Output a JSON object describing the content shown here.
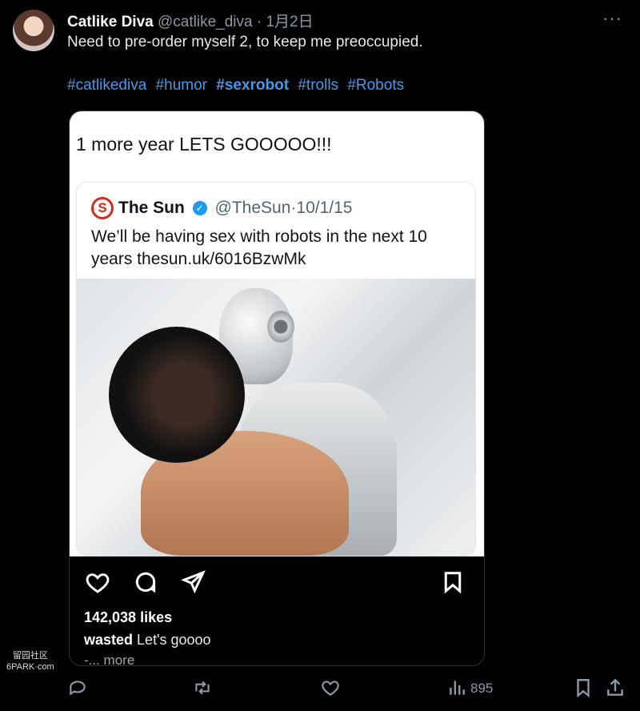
{
  "author": {
    "display_name": "Catlike Diva",
    "handle": "@catlike_diva",
    "date": "1月2日"
  },
  "post": {
    "text": "Need to pre-order myself 2, to keep me preoccupied.",
    "hashtags": [
      "#catlikediva",
      "#humor",
      "#sexrobot",
      "#trolls",
      "#Robots"
    ]
  },
  "card": {
    "caption": "1 more year LETS GOOOOO!!!",
    "quote": {
      "logo_letter": "S",
      "name": "The Sun",
      "handle": "@TheSun",
      "date": "10/1/15",
      "separator": "·",
      "text": "We’ll be having sex with robots in the next 10 years thesun.uk/6016BzwMk"
    },
    "likes": "142,038 likes",
    "caption_user": "wasted",
    "caption_text": "Let's goooo",
    "more_link": "-... more"
  },
  "actions": {
    "views": "895"
  },
  "watermark": {
    "line1": "留园社区",
    "line2": "6PARK·com"
  },
  "colors": {
    "background": "#000000",
    "hashtag": "#4a99e9",
    "verified": "#1d9bf0",
    "sun_red": "#d52b1e",
    "muted": "#8b98a5"
  },
  "icons": {
    "card_actions": [
      "heart-icon",
      "comment-bubble-icon",
      "share-send-icon",
      "bookmark-icon"
    ],
    "post_actions": [
      "reply-icon",
      "repost-icon",
      "like-icon",
      "views-chart-icon",
      "bookmark-icon",
      "share-icon"
    ],
    "header": [
      "more-options-icon"
    ]
  }
}
